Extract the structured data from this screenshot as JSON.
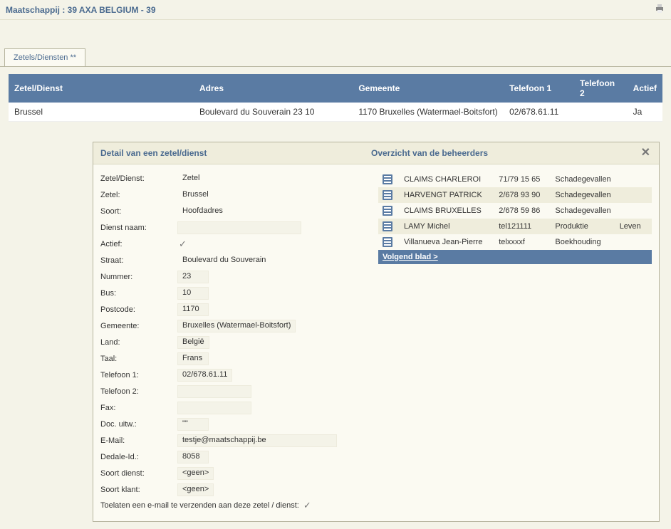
{
  "header": {
    "title": "Maatschappij : 39 AXA BELGIUM - 39"
  },
  "tabs": {
    "active": "Zetels/Diensten **"
  },
  "table": {
    "columns": [
      "Zetel/Dienst",
      "Adres",
      "Gemeente",
      "Telefoon 1",
      "Telefoon 2",
      "Actief"
    ],
    "rows": [
      {
        "zetel": "Brussel",
        "adres": "Boulevard du Souverain 23 10",
        "gemeente": "1170 Bruxelles (Watermael-Boitsfort)",
        "tel1": "02/678.61.11",
        "tel2": "",
        "actief": "Ja"
      }
    ]
  },
  "detail": {
    "title_left": "Detail van een zetel/dienst",
    "title_right": "Overzicht van de beheerders",
    "labels": {
      "zetel_dienst": "Zetel/Dienst:",
      "zetel": "Zetel:",
      "soort": "Soort:",
      "dienst_naam": "Dienst naam:",
      "actief": "Actief:",
      "straat": "Straat:",
      "nummer": "Nummer:",
      "bus": "Bus:",
      "postcode": "Postcode:",
      "gemeente": "Gemeente:",
      "land": "Land:",
      "taal": "Taal:",
      "tel1": "Telefoon 1:",
      "tel2": "Telefoon 2:",
      "fax": "Fax:",
      "doc_uitw": "Doc. uitw.:",
      "email": "E-Mail:",
      "dedale": "Dedale-Id.:",
      "soort_dienst": "Soort dienst:",
      "soort_klant": "Soort klant:",
      "email_allowed": "Toelaten een e-mail te verzenden aan deze zetel / dienst:"
    },
    "fields": {
      "zetel_dienst": "Zetel",
      "zetel": "Brussel",
      "soort": "Hoofdadres",
      "dienst_naam": "",
      "actief": true,
      "straat": "Boulevard du Souverain",
      "nummer": "23",
      "bus": "10",
      "postcode": "1170",
      "gemeente": "Bruxelles (Watermael-Boitsfort)",
      "land": "België",
      "taal": "Frans",
      "tel1": "02/678.61.11",
      "tel2": "",
      "fax": "",
      "doc_uitw": "\"\"",
      "email": "testje@maatschappij.be",
      "dedale": "8058",
      "soort_dienst": "<geen>",
      "soort_klant": "<geen>",
      "email_allowed": true
    }
  },
  "managers": {
    "rows": [
      {
        "name": "CLAIMS CHARLEROI",
        "tel": "71/79 15 65",
        "cat": "Schadegevallen",
        "extra": ""
      },
      {
        "name": "HARVENGT PATRICK",
        "tel": "2/678 93 90",
        "cat": "Schadegevallen",
        "extra": ""
      },
      {
        "name": "CLAIMS BRUXELLES",
        "tel": "2/678 59 86",
        "cat": "Schadegevallen",
        "extra": ""
      },
      {
        "name": "LAMY Michel",
        "tel": "tel121111",
        "cat": "Produktie",
        "extra": "Leven"
      },
      {
        "name": "Villanueva Jean-Pierre",
        "tel": "telxxxxf",
        "cat": "Boekhouding",
        "extra": ""
      }
    ],
    "next_page": "Volgend blad >"
  }
}
